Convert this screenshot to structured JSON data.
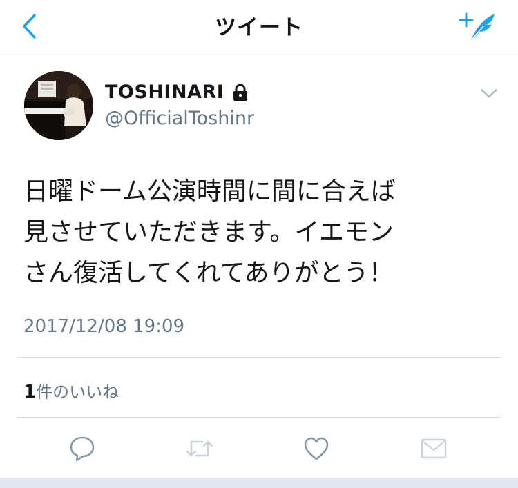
{
  "header": {
    "title": "ツイート",
    "back_icon": "chevron-left-icon",
    "compose_icon": "compose-tweet-icon",
    "accent_color": "#1da1f2"
  },
  "tweet": {
    "display_name": "TOSHINARI",
    "handle": "@OfficialToshinr",
    "protected_icon": "lock-icon",
    "text": "日曜ドーム公演時間に間に合えば\n見させていただきます。イエモン\nさん復活してくれてありがとう！",
    "timestamp": "2017/12/08 19:09",
    "likes_count": "1",
    "likes_label": "件のいいね"
  },
  "actions": [
    {
      "name": "reply",
      "icon": "reply-icon"
    },
    {
      "name": "retweet",
      "icon": "retweet-icon"
    },
    {
      "name": "like",
      "icon": "heart-icon"
    },
    {
      "name": "direct-message",
      "icon": "envelope-icon"
    }
  ]
}
